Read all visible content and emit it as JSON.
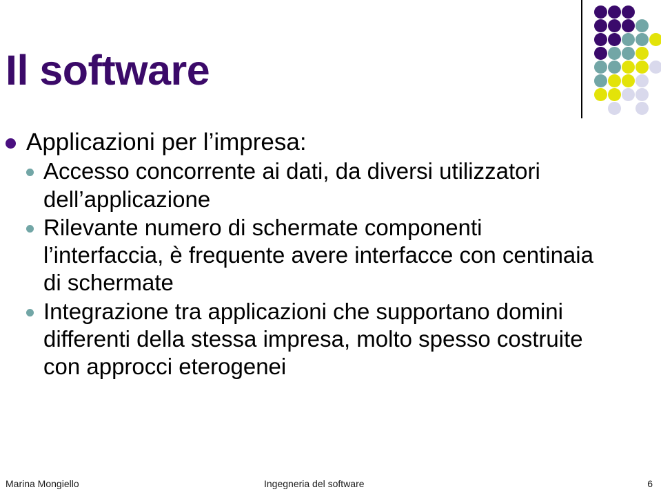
{
  "slide": {
    "title": "Il software",
    "title_color": "#3b0a69",
    "background": "#ffffff"
  },
  "bullets": [
    {
      "level": 1,
      "text": "Applicazioni per l’impresa:",
      "marker_color": "#4a1080"
    },
    {
      "level": 2,
      "text": "Accesso concorrente ai dati, da diversi utilizzatori dell’applicazione",
      "marker_color": "#72a6a6"
    },
    {
      "level": 2,
      "text": "Rilevante numero di schermate componenti l’interfaccia, è frequente avere interfacce con centinaia di schermate",
      "marker_color": "#72a6a6"
    },
    {
      "level": 2,
      "text": "Integrazione tra applicazioni che supportano domini differenti della stessa impresa, molto spesso costruite con approcci eterogenei",
      "marker_color": "#72a6a6"
    }
  ],
  "footer": {
    "author": "Marina Mongiello",
    "course": "Ingegneria del software",
    "page": "6"
  },
  "decoration": {
    "palette": {
      "purple": "#3a0a6b",
      "teal": "#72a6a6",
      "yellow": "#e3e309",
      "lavender": "#d9d9ec"
    },
    "dot_size": 19,
    "step_x": 20,
    "step_y": 20,
    "rows": [
      [
        "purple",
        "purple",
        "purple",
        null,
        null
      ],
      [
        "purple",
        "purple",
        "purple",
        "teal",
        null
      ],
      [
        "purple",
        "purple",
        "teal",
        "teal",
        "yellow"
      ],
      [
        "purple",
        "teal",
        "teal",
        "yellow",
        null
      ],
      [
        "teal",
        "teal",
        "yellow",
        "yellow",
        "lavender"
      ],
      [
        "teal",
        "yellow",
        "yellow",
        "lavender",
        null
      ],
      [
        "yellow",
        "yellow",
        "lavender",
        "lavender",
        null
      ],
      [
        null,
        "lavender",
        null,
        "lavender",
        null
      ]
    ]
  }
}
